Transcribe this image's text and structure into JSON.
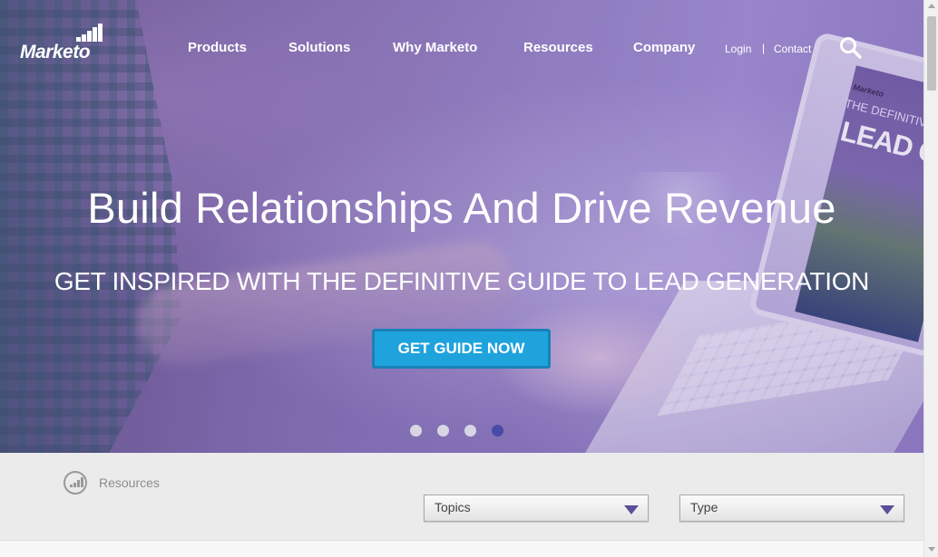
{
  "brand": {
    "name": "Marketo",
    "icon": "marketo-bars-logo"
  },
  "nav": {
    "items": [
      {
        "label": "Products"
      },
      {
        "label": "Solutions"
      },
      {
        "label": "Why Marketo"
      },
      {
        "label": "Resources"
      },
      {
        "label": "Company"
      }
    ],
    "login": "Login",
    "separator": "|",
    "contact": "Contact",
    "search_icon": "search-icon"
  },
  "hero": {
    "headline": "Build Relationships And Drive Revenue",
    "subhead": "GET INSPIRED WITH THE DEFINITIVE GUIDE TO LEAD GENERATION",
    "cta": "GET GUIDE NOW",
    "book": {
      "brand": "Marketo",
      "subtitle": "THE DEFINITIVE G",
      "title": "LEAD GEN"
    },
    "carousel": {
      "slides": 4,
      "active_index": 3
    }
  },
  "resources": {
    "label": "Resources",
    "icon": "resources-chart-icon",
    "filters": [
      {
        "label": "Topics"
      },
      {
        "label": "Type"
      }
    ]
  },
  "colors": {
    "cta_bg": "#1fa3dd",
    "cta_border": "#1882b6",
    "dot_active": "#4a4aa8",
    "dot_inactive": "#d9d6e4",
    "caret": "#5c4e9a",
    "resources_bg": "#ebebeb"
  }
}
